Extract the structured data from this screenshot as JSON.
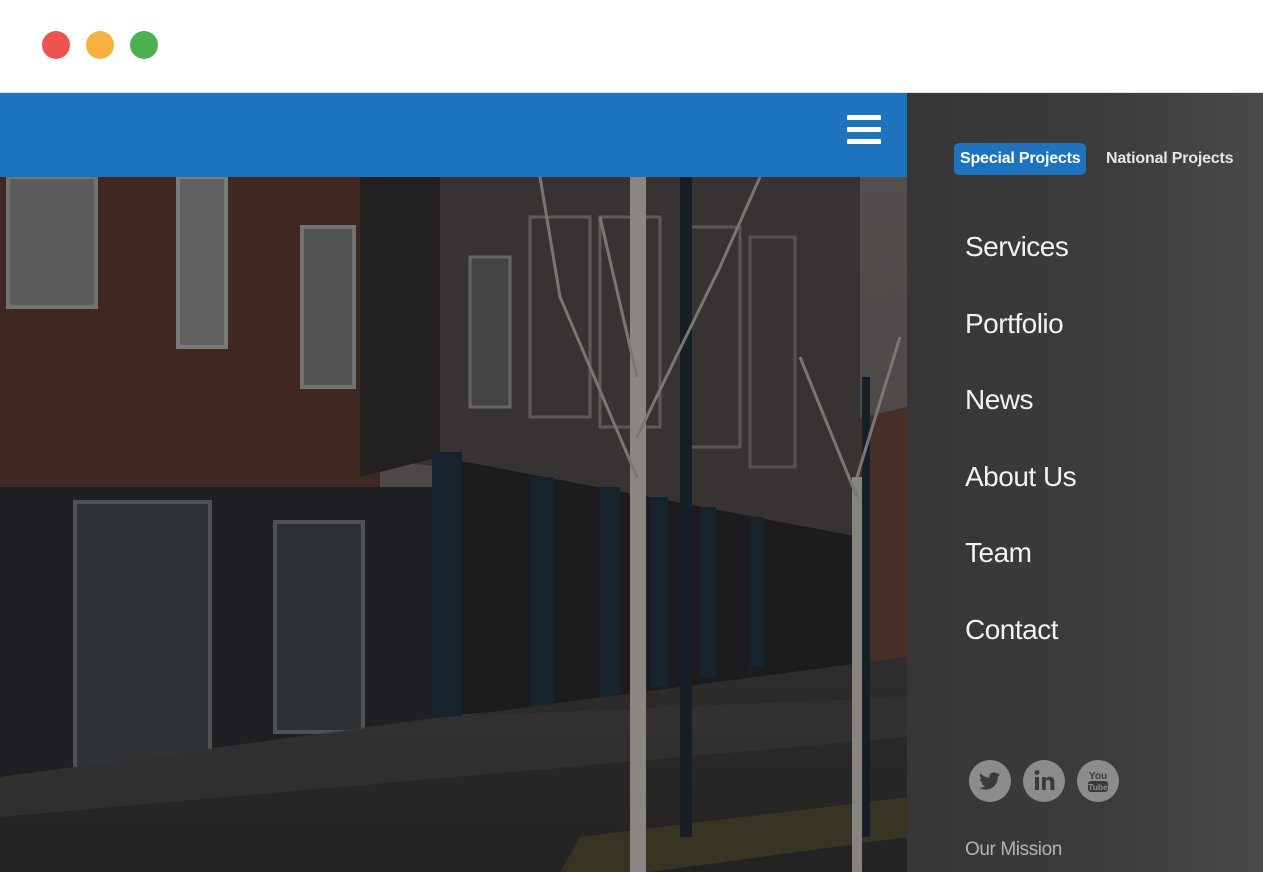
{
  "window": {
    "controls": [
      "close",
      "minimize",
      "maximize"
    ]
  },
  "header": {
    "menu_icon": "hamburger-menu-icon",
    "bar_color": "#1e73be"
  },
  "panel": {
    "tabs": [
      {
        "label": "Special Projects",
        "active": true
      },
      {
        "label": "National Projects",
        "active": false
      }
    ],
    "menu": [
      {
        "label": "Services"
      },
      {
        "label": "Portfolio"
      },
      {
        "label": "News"
      },
      {
        "label": "About Us"
      },
      {
        "label": "Team"
      },
      {
        "label": "Contact"
      }
    ],
    "social": [
      "twitter-icon",
      "linkedin-icon",
      "youtube-icon"
    ],
    "youtube_text": {
      "top": "You",
      "bottom": "Tube"
    },
    "footer_link": "Our Mission"
  },
  "colors": {
    "accent": "#1e73be",
    "panel_bg": "#3a3a3a",
    "menu_text": "#f2f2f2",
    "social_bg": "#8c8c8c"
  }
}
